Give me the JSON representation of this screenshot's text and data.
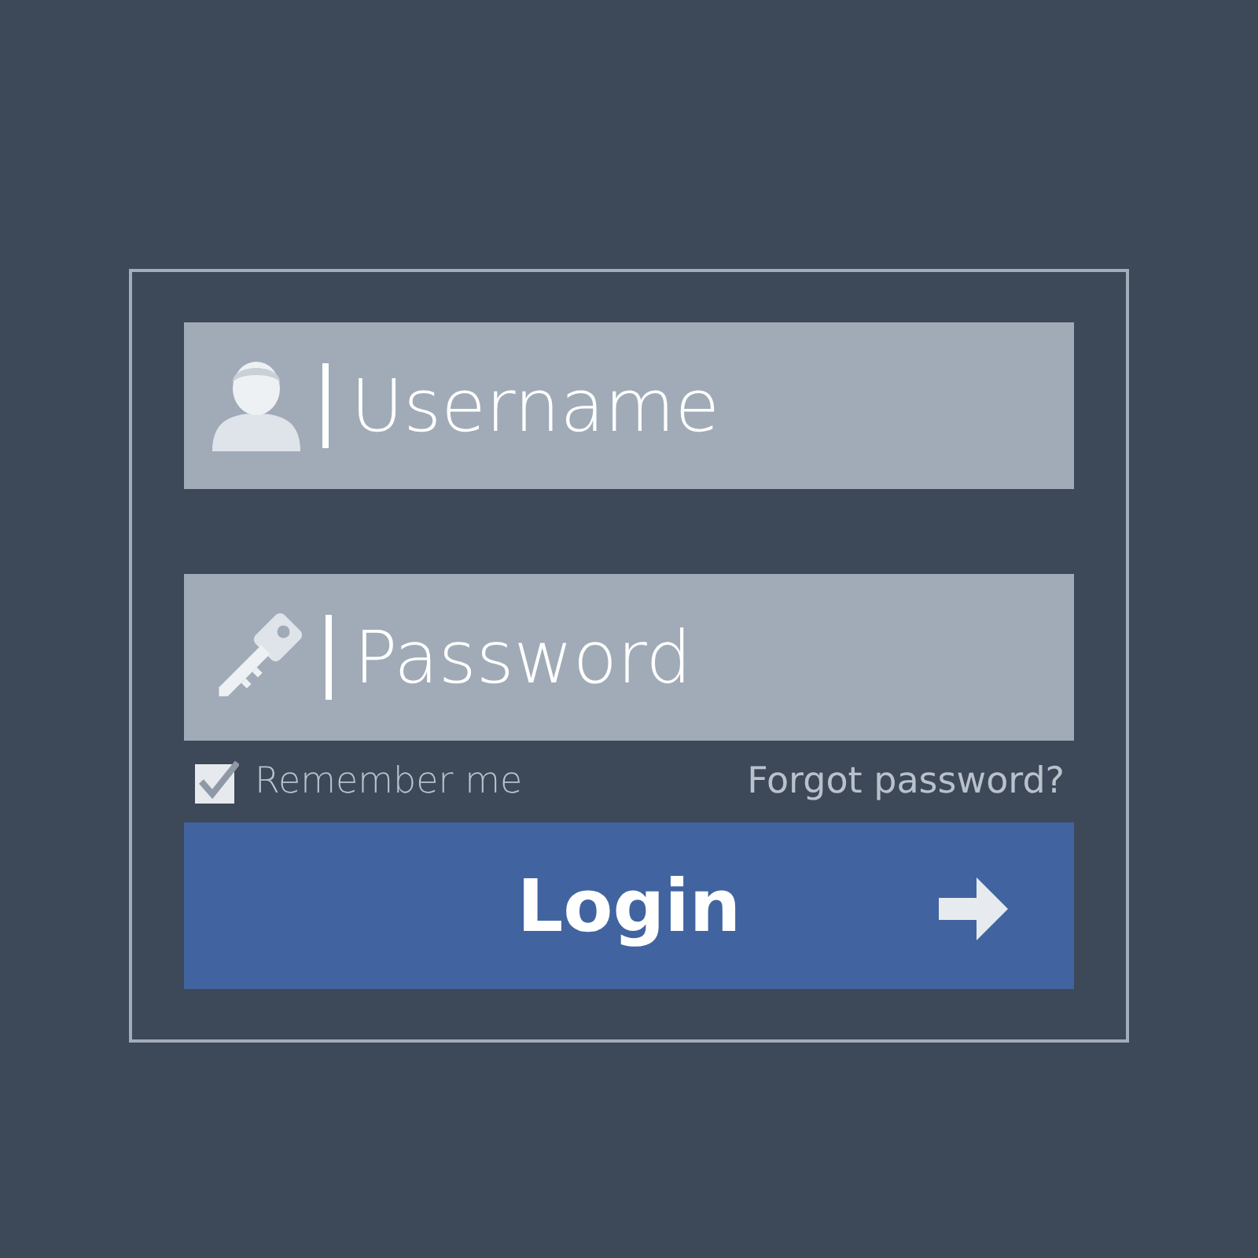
{
  "login_form": {
    "username": {
      "placeholder": "Username"
    },
    "password": {
      "placeholder": "Password"
    },
    "remember": {
      "label": "Remember me",
      "checked": true
    },
    "forgot_link": "Forgot password?",
    "login_button": "Login"
  }
}
